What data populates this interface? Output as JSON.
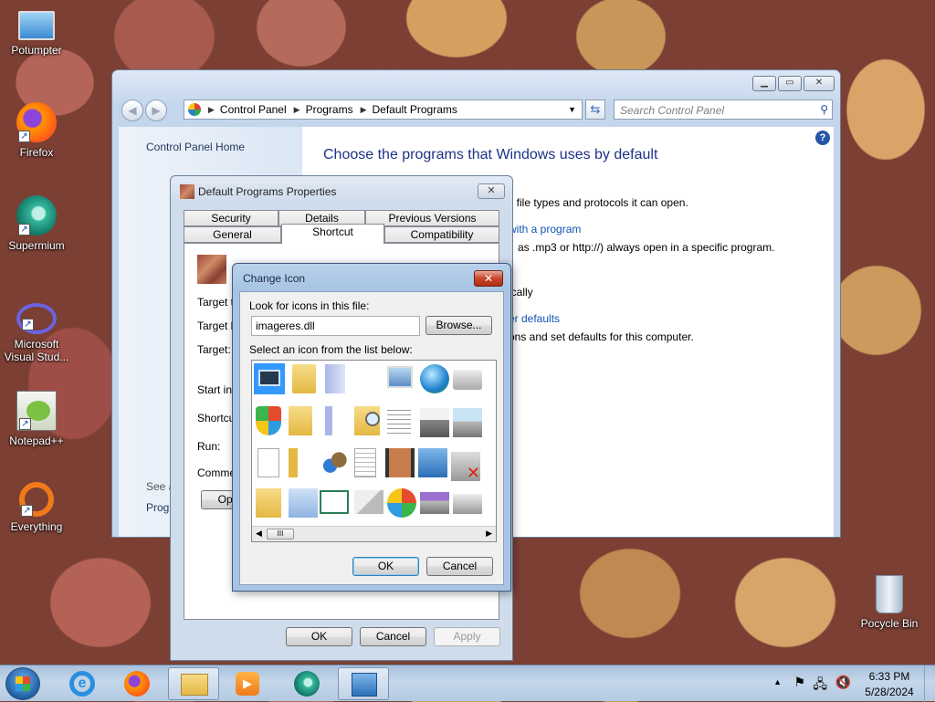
{
  "desktop": {
    "icons": [
      {
        "label": "Potumpter",
        "icon": "computer-icon"
      },
      {
        "label": "Firefox",
        "icon": "firefox-icon"
      },
      {
        "label": "Supermium",
        "icon": "supermium-icon"
      },
      {
        "label": "Microsoft Visual Stud...",
        "icon": "visual-studio-icon"
      },
      {
        "label": "Notepad++",
        "icon": "notepad-plus-plus-icon"
      },
      {
        "label": "Everything",
        "icon": "everything-search-icon"
      },
      {
        "label": "Pocycle Bin",
        "icon": "recycle-bin-icon"
      }
    ]
  },
  "control_panel": {
    "breadcrumb": [
      "Control Panel",
      "Programs",
      "Default Programs"
    ],
    "search_placeholder": "Search Control Panel",
    "sidebar": {
      "home": "Control Panel Home",
      "see_also": "See a",
      "programs": "Progr"
    },
    "title": "Choose the programs that Windows uses by default",
    "lines": [
      "ll file types and protocols it can open.",
      "with a program",
      "as .mp3 or http://) always open in a specific program.",
      "ically",
      "er defaults",
      "ons and set defaults for this computer."
    ]
  },
  "properties": {
    "title": "Default Programs Properties",
    "tabs_row1": [
      "Security",
      "Details",
      "Previous Versions"
    ],
    "tabs_row2": [
      "General",
      "Shortcut",
      "Compatibility"
    ],
    "active_tab": "Shortcut",
    "labels": [
      "Target ty",
      "Target lo",
      "Target:",
      "Start in:",
      "Shortcut",
      "Run:",
      "Commen"
    ],
    "open_button": "Ope",
    "buttons": {
      "ok": "OK",
      "cancel": "Cancel",
      "apply": "Apply"
    }
  },
  "change_icon": {
    "title": "Change Icon",
    "look_label": "Look for icons in this file:",
    "file_value": "imageres.dll",
    "browse": "Browse...",
    "list_label": "Select an icon from the list below:",
    "ok": "OK",
    "cancel": "Cancel",
    "scroll_thumb": "III"
  },
  "taskbar": {
    "time": "6:33 PM",
    "date": "5/28/2024",
    "apps": [
      "internet-explorer-icon",
      "firefox-icon",
      "file-explorer-icon",
      "media-player-icon",
      "supermium-icon",
      "control-panel-icon"
    ]
  },
  "colors": {
    "accent": "#1e3287",
    "link": "#0f53b6",
    "close_red": "#c7462c",
    "selection": "#3399ff"
  }
}
